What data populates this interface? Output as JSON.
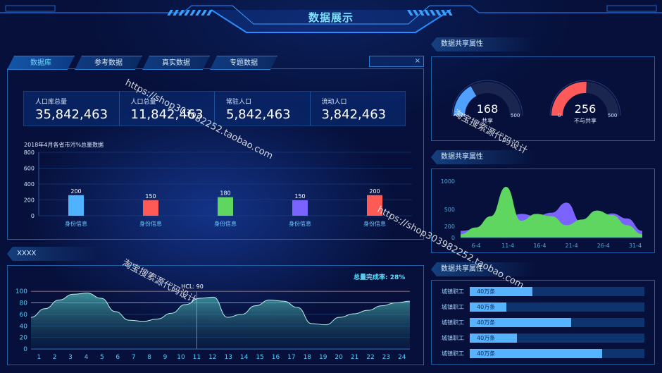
{
  "header": {
    "title": "数据展示"
  },
  "tabs": [
    {
      "label": "数据库"
    },
    {
      "label": "参考数据"
    },
    {
      "label": "真实数据"
    },
    {
      "label": "专题数据"
    }
  ],
  "close_glyph": "×",
  "stats": [
    {
      "label": "人口库总量",
      "value": "35,842,463"
    },
    {
      "label": "人口总量",
      "value": "11,842,463"
    },
    {
      "label": "常驻人口",
      "value": "5,842,463"
    },
    {
      "label": "流动人口",
      "value": "3,842,463"
    }
  ],
  "bar_chart_title": "2018年4月各省市污%总量数据",
  "bottom_section": {
    "label": "XXXX",
    "rate_label": "总量完成率: 28%"
  },
  "right_sections": [
    {
      "label": "数据共享属性"
    },
    {
      "label": "数据共享属性"
    },
    {
      "label": "数据共享属性"
    }
  ],
  "gauges": [
    {
      "value": "168",
      "label": "共享",
      "min": "0",
      "max": "500",
      "fraction": 0.336,
      "color": "#4fa0ff"
    },
    {
      "value": "256",
      "label": "不与共享",
      "min": "0",
      "max": "500",
      "fraction": 0.512,
      "color": "#ff5a5a"
    }
  ],
  "progress_bars": [
    {
      "label": "城镇职工",
      "text": "40万条",
      "fraction": 0.36
    },
    {
      "label": "城镇职工",
      "text": "40万条",
      "fraction": 0.21
    },
    {
      "label": "城镇职工",
      "text": "40万条",
      "fraction": 0.58
    },
    {
      "label": "城镇职工",
      "text": "40万条",
      "fraction": 0.27
    },
    {
      "label": "城镇职工",
      "text": "40万条",
      "fraction": 0.76
    }
  ],
  "watermarks": {
    "url": "https://shop303982252.taobao.com",
    "shop": "淘宝搜索源代码设计"
  },
  "chart_data": [
    {
      "type": "bar",
      "categories": [
        "身份信息",
        "身份信息",
        "身份信息",
        "身份信息",
        "身份信息"
      ],
      "values": [
        200,
        150,
        180,
        150,
        200
      ],
      "colors": [
        "#4fb3ff",
        "#ff5a55",
        "#5fd65f",
        "#7b63ff",
        "#ff5a55"
      ],
      "y_ticks": [
        "0",
        "200",
        "400",
        "600",
        "800"
      ],
      "ylim": [
        0,
        800
      ],
      "note": "bars drawn at height ~ values shown on axis scale"
    },
    {
      "type": "area",
      "x": [
        "6-4",
        "11-4",
        "16-4",
        "21-4",
        "26-4",
        "31-4"
      ],
      "y_ticks": [
        "0",
        "200",
        "500",
        "1000"
      ],
      "ylim": [
        0,
        1000
      ],
      "series": [
        {
          "color": "#7b63ff",
          "values": [
            120,
            150,
            250,
            320,
            420,
            380,
            440,
            620,
            260,
            300,
            430,
            340,
            120
          ]
        },
        {
          "color": "#5fd65f",
          "values": [
            60,
            180,
            380,
            900,
            300,
            420,
            380,
            220,
            320,
            480,
            400,
            220,
            60
          ]
        }
      ]
    },
    {
      "type": "area",
      "x": [
        "1",
        "2",
        "3",
        "4",
        "5",
        "6",
        "7",
        "8",
        "9",
        "10",
        "11",
        "12",
        "13",
        "14",
        "15",
        "16",
        "17",
        "18",
        "19",
        "20",
        "21",
        "22",
        "23",
        "24"
      ],
      "y_ticks": [
        "0",
        "20",
        "40",
        "60",
        "80",
        "100"
      ],
      "ylim": [
        0,
        110
      ],
      "values": [
        55,
        70,
        85,
        95,
        97,
        88,
        65,
        50,
        48,
        52,
        62,
        77,
        88,
        90,
        55,
        60,
        75,
        85,
        83,
        72,
        44,
        42,
        55,
        61,
        67,
        75,
        80,
        83
      ],
      "reference_lines": [
        {
          "label": "HCL: 90",
          "value": 100
        },
        {
          "value": 80
        }
      ],
      "marker_label": "HCL: 90"
    }
  ]
}
